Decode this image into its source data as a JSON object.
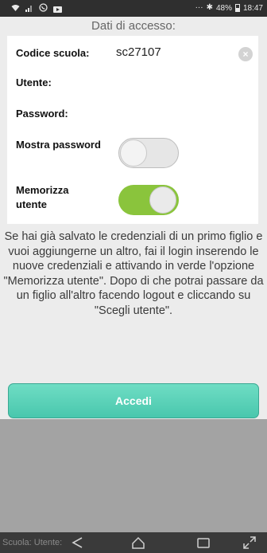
{
  "status_bar": {
    "battery_text": "48%",
    "time": "18:47",
    "icons": [
      "wifi-icon",
      "signal-icon",
      "whatsapp-icon",
      "video-icon",
      "bluetooth-icon",
      "battery-icon"
    ]
  },
  "header": {
    "title": "Dati di accesso:"
  },
  "form": {
    "school_code": {
      "label": "Codice scuola:",
      "value": "sc27107"
    },
    "user": {
      "label": "Utente:",
      "value": ""
    },
    "password": {
      "label": "Password:",
      "value": ""
    },
    "show_password": {
      "label": "Mostra password",
      "checked": false
    },
    "remember_user": {
      "label": "Memorizza utente",
      "checked": true
    }
  },
  "info_text": "Se hai già salvato le credenziali di un primo figlio e vuoi aggiungerne un altro, fai il login inserendo le nuove credenziali e attivando in verde l'opzione \"Memorizza utente\". Dopo di che potrai passare da un figlio all'altro facendo logout e cliccando su \"Scegli utente\".",
  "login_button": "Accedi",
  "footer": {
    "text": "Scuola: Utente:"
  },
  "colors": {
    "accent_green": "#8ac43c",
    "button_teal": "#5dd3b8"
  }
}
